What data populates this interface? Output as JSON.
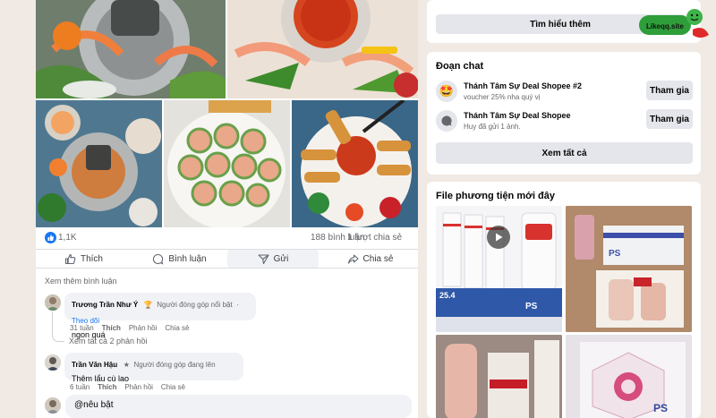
{
  "post": {
    "reaction_count": "1,1K",
    "comment_count": "188 bình luận",
    "share_count": "1 lượt chia sẻ",
    "actions": [
      "Thích",
      "Bình luận",
      "Gửi",
      "Chia sẻ"
    ]
  },
  "comments": {
    "view_more": "Xem thêm bình luận",
    "items": [
      {
        "author": "Trương Trần Như Ý",
        "badge": "Người đóng góp nổi bật",
        "follow": "Theo dõi",
        "text": "ngon quá",
        "time": "31 tuần",
        "like": "Thích",
        "reply": "Phản hồi",
        "share": "Chia sẻ"
      },
      {
        "author": "Trần Văn Hậu",
        "badge": "Người đóng góp đang lên",
        "text": "Thêm lẩu cù lao",
        "time": "6 tuần",
        "like": "Thích",
        "reply": "Phản hồi",
        "share": "Chia sẻ"
      }
    ],
    "view_replies": "Xem tất cả 2 phản hồi",
    "composer_value": "@nêu bật"
  },
  "sidebar": {
    "learn_more": "Tìm hiểu thêm",
    "chats": {
      "title": "Đoạn chat",
      "items": [
        {
          "name": "Thánh Tâm Sự Deal Shopee #2",
          "sub": "voucher 25% nha quý vị",
          "join": "Tham gia"
        },
        {
          "name": "Thánh Tâm Sự Deal Shopee",
          "sub": "Huy đã gửi 1 ảnh.",
          "join": "Tham gia"
        }
      ],
      "see_all": "Xem tất cả"
    },
    "media": {
      "title": "File phương tiện mới đây",
      "labels": [
        "PS",
        "25.4",
        "PS",
        "PS"
      ]
    }
  },
  "watermark": {
    "text": "Likeqq.site"
  },
  "colors": {
    "brand": "#1877f2",
    "button_bg": "#e4e6eb",
    "page_bg": "#f0e9e4",
    "watermark": "#2e9e3a"
  }
}
